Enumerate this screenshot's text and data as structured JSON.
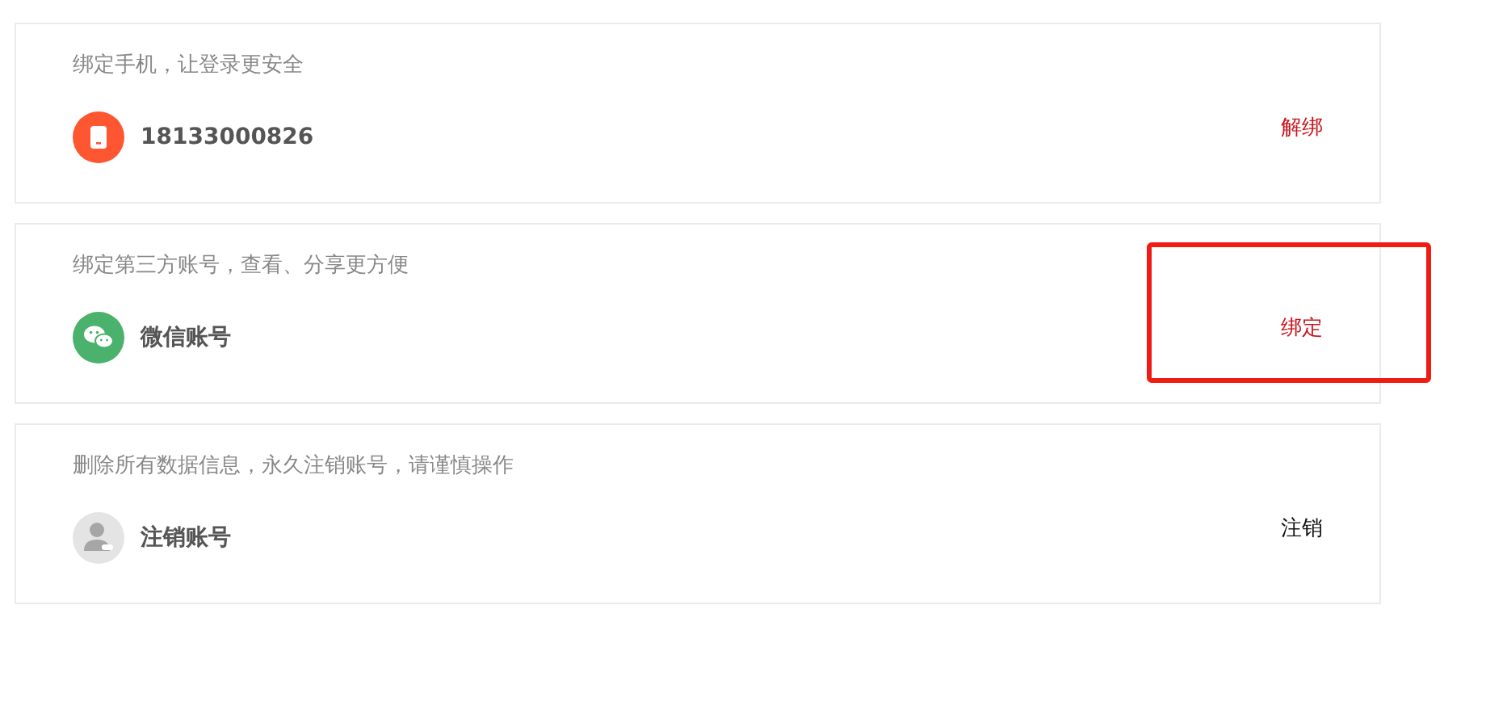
{
  "cards": [
    {
      "hint": "绑定手机，让登录更安全",
      "kind": "phone",
      "label": "18133000826",
      "action": "解绑",
      "color": "#c8161d",
      "highlighted": false
    },
    {
      "hint": "绑定第三方账号，查看、分享更方便",
      "kind": "wechat",
      "label": "微信账号",
      "action": "绑定",
      "color": "#c8161d",
      "highlighted": true
    },
    {
      "hint": "删除所有数据信息，永久注销账号，请谨慎操作",
      "kind": "user",
      "label": "注销账号",
      "action": "注销",
      "color": "#111111",
      "highlighted": false
    }
  ]
}
